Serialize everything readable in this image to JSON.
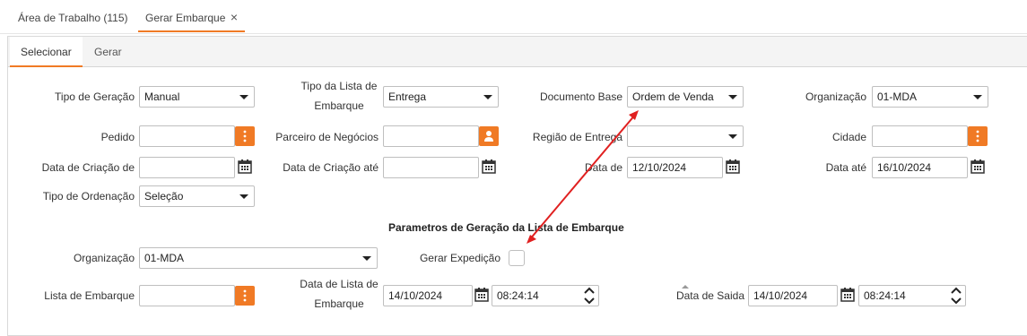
{
  "top_tabs": [
    {
      "label": "Área de Trabalho (115)"
    },
    {
      "label": "Gerar Embarque",
      "close": "×"
    }
  ],
  "sub_tabs": [
    {
      "label": "Selecionar"
    },
    {
      "label": "Gerar"
    }
  ],
  "filters": {
    "tipo_geracao": {
      "label": "Tipo de Geração",
      "value": "Manual"
    },
    "tipo_lista": {
      "label_line1": "Tipo da Lista de",
      "label_line2": "Embarque",
      "value": "Entrega"
    },
    "documento_base": {
      "label": "Documento Base",
      "value": "Ordem de Venda"
    },
    "organizacao": {
      "label": "Organização",
      "value": "01-MDA"
    },
    "pedido": {
      "label": "Pedido",
      "value": ""
    },
    "parceiro": {
      "label": "Parceiro de Negócios",
      "value": ""
    },
    "regiao": {
      "label": "Região de Entrega",
      "value": ""
    },
    "cidade": {
      "label": "Cidade",
      "value": ""
    },
    "data_criacao_de": {
      "label": "Data de Criação de",
      "value": ""
    },
    "data_criacao_ate": {
      "label": "Data de Criação até",
      "value": ""
    },
    "data_de": {
      "label": "Data de",
      "value": "12/10/2024"
    },
    "data_ate": {
      "label": "Data até",
      "value": "16/10/2024"
    },
    "tipo_ordenacao": {
      "label": "Tipo de Ordenação",
      "value": "Seleção"
    }
  },
  "params": {
    "title": "Parametros de Geração da Lista de Embarque",
    "organizacao": {
      "label": "Organização",
      "value": "01-MDA"
    },
    "gerar_expedicao": {
      "label": "Gerar Expedição",
      "checked": false
    },
    "lista_embarque": {
      "label": "Lista de Embarque",
      "value": ""
    },
    "data_lista": {
      "label_line1": "Data de Lista de",
      "label_line2": "Embarque",
      "date": "14/10/2024",
      "time": "08:24:14"
    },
    "data_saida": {
      "label": "Data de Saida",
      "date": "14/10/2024",
      "time": "08:24:14"
    }
  },
  "colors": {
    "accent": "#f07a25",
    "annotation_arrow": "#e02020"
  },
  "icons": {
    "calendar": "calendar-icon",
    "menu": "kebab-menu-icon",
    "person": "person-icon",
    "spinner": "time-spinner-icon"
  }
}
